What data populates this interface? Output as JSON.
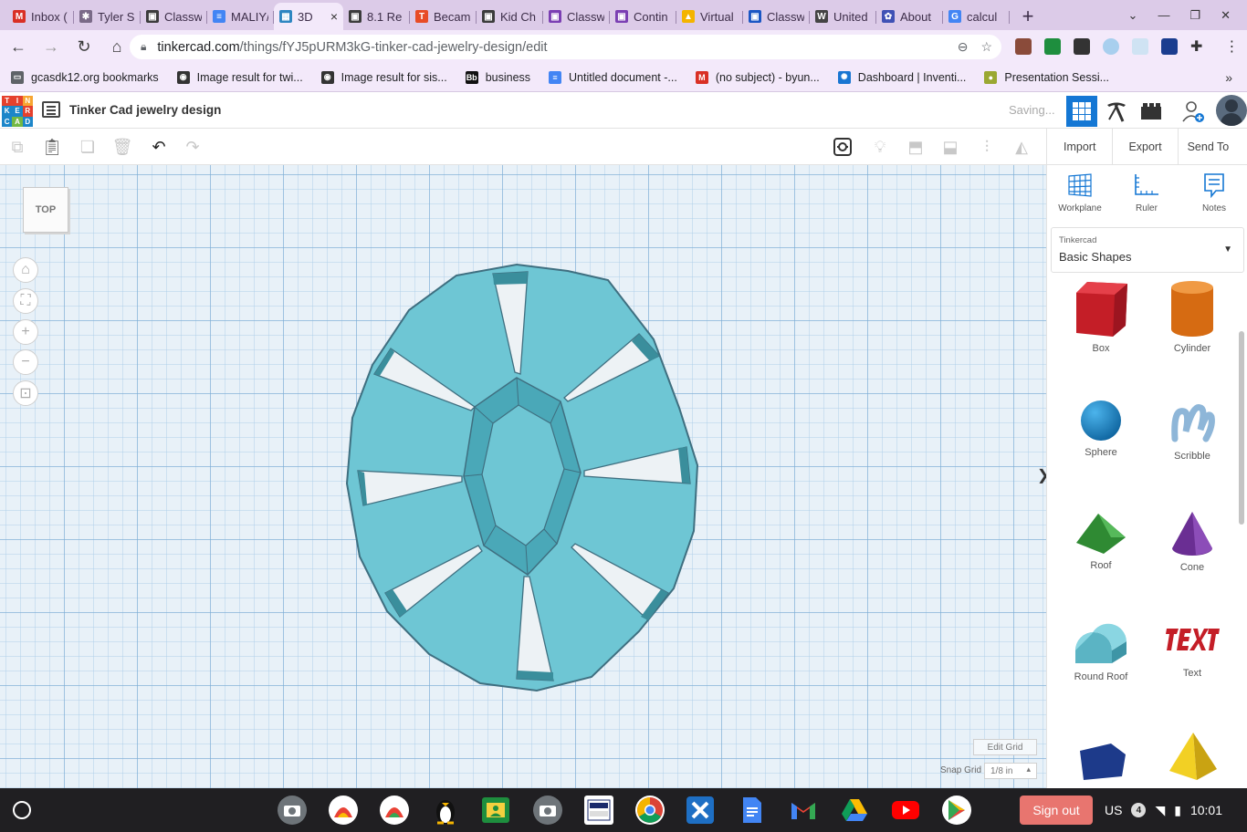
{
  "browser": {
    "tabs": [
      {
        "label": "Inbox (",
        "icon": "gmail-icon",
        "color": "#d93025",
        "letter": "M"
      },
      {
        "label": "Tyler S",
        "icon": "tool-icon",
        "color": "#7a6a88",
        "letter": "✱"
      },
      {
        "label": "Classw",
        "icon": "classroom-icon",
        "color": "#3c3c3c",
        "letter": "▣"
      },
      {
        "label": "MALIY/",
        "icon": "docs-icon",
        "color": "#4285f4",
        "letter": "≡"
      },
      {
        "label": "3D",
        "icon": "tinkercad-icon",
        "color": "#2e86c1",
        "letter": "▦",
        "active": true
      },
      {
        "label": "8.1 Re",
        "icon": "classroom-icon",
        "color": "#3c3c3c",
        "letter": "▣"
      },
      {
        "label": "Becam",
        "icon": "tab-t-icon",
        "color": "#e84c26",
        "letter": "T"
      },
      {
        "label": "Kid Ch",
        "icon": "classroom-icon",
        "color": "#3c3c3c",
        "letter": "▣"
      },
      {
        "label": "Classw",
        "icon": "classroom-icon",
        "color": "#7b3fb3",
        "letter": "▣"
      },
      {
        "label": "Contin",
        "icon": "classroom-icon",
        "color": "#7b3fb3",
        "letter": "▣"
      },
      {
        "label": "Virtual",
        "icon": "drive-icon",
        "color": "#f4b400",
        "letter": "▲"
      },
      {
        "label": "Classw",
        "icon": "classroom-icon",
        "color": "#1a56c4",
        "letter": "▣"
      },
      {
        "label": "United",
        "icon": "wikipedia-icon",
        "color": "#444444",
        "letter": "W"
      },
      {
        "label": "About",
        "icon": "globe-icon",
        "color": "#3f51b5",
        "letter": "✿"
      },
      {
        "label": "calcul",
        "icon": "google-icon",
        "color": "#4285f4",
        "letter": "G"
      }
    ],
    "active_tab_close": "×",
    "new_tab": "+",
    "url_host": "tinkercad.com",
    "url_path": "/things/fYJ5pURM3kG-tinker-cad-jewelry-design/edit",
    "bookmarks": [
      {
        "label": "gcasdk12.org bookmarks",
        "icon": "folder-icon",
        "color": "#5f6368",
        "letter": "▭"
      },
      {
        "label": "Image result for twi...",
        "icon": "globe-icon",
        "color": "#333333",
        "letter": "◉"
      },
      {
        "label": "Image result for sis...",
        "icon": "globe-icon",
        "color": "#333333",
        "letter": "◉"
      },
      {
        "label": "business",
        "icon": "blackboard-icon",
        "color": "#111111",
        "letter": "Bb"
      },
      {
        "label": "Untitled document -...",
        "icon": "docs-icon",
        "color": "#4285f4",
        "letter": "≡"
      },
      {
        "label": "(no subject) - byun...",
        "icon": "gmail-icon",
        "color": "#d93025",
        "letter": "M"
      },
      {
        "label": "Dashboard | Inventi...",
        "icon": "gear-icon",
        "color": "#1976d2",
        "letter": "✺"
      },
      {
        "label": "Presentation Sessi...",
        "icon": "pear-icon",
        "color": "#9aa832",
        "letter": "●"
      }
    ],
    "bookmarks_more": "»"
  },
  "tinkercad": {
    "logo_letters": [
      "T",
      "I",
      "N",
      "K",
      "E",
      "R",
      "C",
      "A",
      "D"
    ],
    "logo_colors": [
      "#e5412d",
      "#e5412d",
      "#f7a531",
      "#1c86c9",
      "#1c86c9",
      "#e5412d",
      "#1c86c9",
      "#73b843",
      "#1c86c9"
    ],
    "design_title": "Tinker Cad jewelry design",
    "status": "Saving...",
    "actions": {
      "import": "Import",
      "export": "Export",
      "send_to": "Send To"
    },
    "viewcube_label": "TOP",
    "edit_grid": "Edit Grid",
    "snap_grid_label": "Snap Grid",
    "snap_grid_value": "1/8 in",
    "panel_toggle": "❯",
    "panel_tools": [
      {
        "label": "Workplane",
        "icon": "workplane-icon"
      },
      {
        "label": "Ruler",
        "icon": "ruler-icon"
      },
      {
        "label": "Notes",
        "icon": "notes-icon"
      }
    ],
    "library_source": "Tinkercad",
    "library_name": "Basic Shapes",
    "shapes": [
      {
        "label": "Box",
        "icon": "box-icon",
        "color": "#d6262f"
      },
      {
        "label": "Cylinder",
        "icon": "cylinder-icon",
        "color": "#e87d1e"
      },
      {
        "label": "Sphere",
        "icon": "sphere-icon",
        "color": "#1c8fd2"
      },
      {
        "label": "Scribble",
        "icon": "scribble-icon",
        "color": "#9bbedc"
      },
      {
        "label": "Roof",
        "icon": "roof-icon",
        "color": "#3aa33e"
      },
      {
        "label": "Cone",
        "icon": "cone-icon",
        "color": "#7a3aa3"
      },
      {
        "label": "Round Roof",
        "icon": "round-roof-icon",
        "color": "#6ec8d6"
      },
      {
        "label": "Text",
        "icon": "text-shape-icon",
        "color": "#d6262f"
      },
      {
        "label": "",
        "icon": "polygon-icon",
        "color": "#213f8f"
      },
      {
        "label": "",
        "icon": "pyramid-icon",
        "color": "#e8c21e"
      }
    ]
  },
  "shelf": {
    "signout": "Sign out",
    "locale": "US",
    "notifications": "4",
    "time": "10:01"
  }
}
